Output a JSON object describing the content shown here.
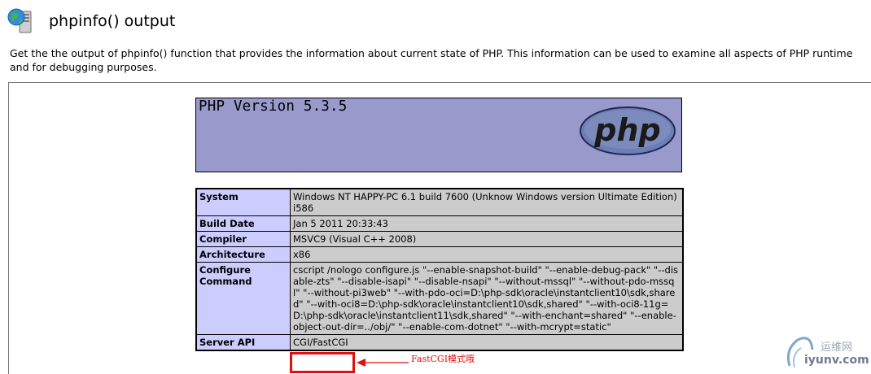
{
  "header": {
    "title": "phpinfo() output",
    "icon": "globe-server-icon"
  },
  "description": "Get the the output of phpinfo() function that provides the information about current state of PHP. This information can be used to examine all aspects of PHP runtime and for debugging purposes.",
  "php": {
    "version_heading": "PHP Version 5.3.5",
    "logo_text": "php"
  },
  "info_rows": [
    {
      "label": "System",
      "value": "Windows NT HAPPY-PC 6.1 build 7600 (Unknow Windows version Ultimate Edition) i586"
    },
    {
      "label": "Build Date",
      "value": "Jan 5 2011 20:33:43"
    },
    {
      "label": "Compiler",
      "value": "MSVC9 (Visual C++ 2008)"
    },
    {
      "label": "Architecture",
      "value": "x86"
    },
    {
      "label": "Configure Command",
      "value": "cscript /nologo configure.js \"--enable-snapshot-build\" \"--enable-debug-pack\" \"--disable-zts\" \"--disable-isapi\" \"--disable-nsapi\" \"--without-mssql\" \"--without-pdo-mssql\" \"--without-pi3web\" \"--with-pdo-oci=D:\\php-sdk\\oracle\\instantclient10\\sdk,shared\" \"--with-oci8=D:\\php-sdk\\oracle\\instantclient10\\sdk,shared\" \"--with-oci8-11g=D:\\php-sdk\\oracle\\instantclient11\\sdk,shared\" \"--with-enchant=shared\" \"--enable-object-out-dir=../obj/\" \"--enable-com-dotnet\" \"--with-mcrypt=static\""
    },
    {
      "label": "Server API",
      "value": "CGI/FastCGI"
    }
  ],
  "annotation": {
    "text": "FastCGI模式哦",
    "color": "#e01010"
  },
  "watermark": {
    "line1": "运维网",
    "line2": "iyunv.com"
  },
  "colors": {
    "php_header_bg": "#9999cc",
    "label_cell_bg": "#ccccff",
    "value_cell_bg": "#cccccc",
    "highlight": "#e01010"
  }
}
